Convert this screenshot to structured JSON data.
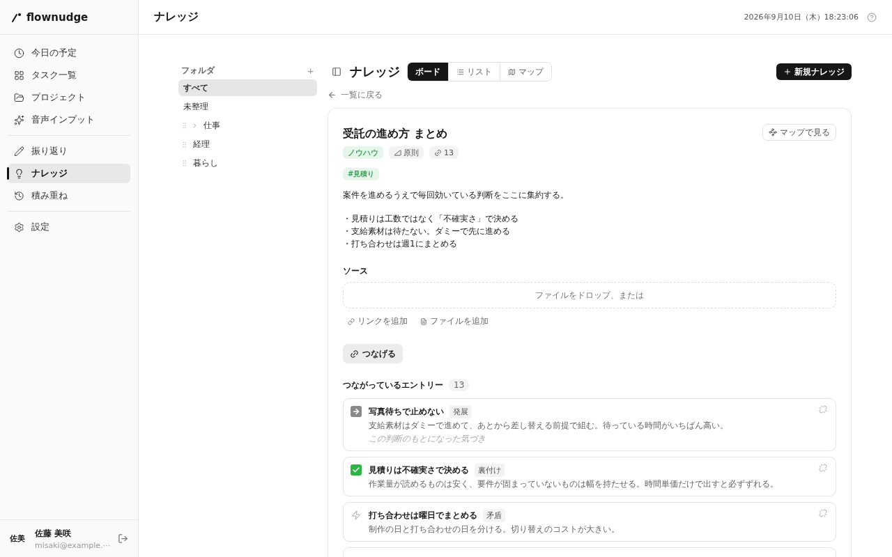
{
  "brand": {
    "name": "flownudge"
  },
  "nav": [
    [
      {
        "label": "今日の予定",
        "selected": false
      },
      {
        "label": "タスク一覧",
        "selected": false
      },
      {
        "label": "プロジェクト",
        "selected": false
      },
      {
        "label": "音声インプット",
        "selected": false
      }
    ],
    [
      {
        "label": "振り返り",
        "selected": false
      },
      {
        "label": "ナレッジ",
        "selected": true
      },
      {
        "label": "積み重ね",
        "selected": false
      }
    ],
    [
      {
        "label": "設定",
        "selected": false
      }
    ]
  ],
  "user": {
    "avatar": "佐美",
    "name": "佐藤 美咲",
    "email": "misaki@example.⋯"
  },
  "header": {
    "title": "ナレッジ",
    "datetime": "2026年9月10日（木）18:23:06"
  },
  "folders": {
    "title": "フォルダ",
    "add": "+",
    "items": [
      {
        "label": "すべて",
        "kind": "system",
        "selected": true
      },
      {
        "label": "未整理",
        "kind": "system",
        "selected": false
      },
      {
        "label": "仕事",
        "kind": "user",
        "selected": false,
        "expanded": false
      },
      {
        "label": "経理",
        "kind": "user",
        "selected": false
      },
      {
        "label": "暮らし",
        "kind": "user",
        "selected": false
      }
    ]
  },
  "page": {
    "title": "ナレッジ",
    "tabs": [
      {
        "label": "ボード",
        "selected": true
      },
      {
        "label": "リスト",
        "selected": false
      },
      {
        "label": "マップ",
        "selected": false
      }
    ],
    "new_button": "新規ナレッジ",
    "back": "一覧に戻る"
  },
  "detail": {
    "title": "受託の進め方 まとめ",
    "map_button": "マップで見る",
    "type_tag": "ノウハウ",
    "category": "原則",
    "link_count": "13",
    "hashtag": "#見積り",
    "intro": "案件を進めるうえで毎回効いている判断をここに集約する。",
    "bullets": [
      "・見積りは工数ではなく「不確実さ」で決める",
      "・支給素材は待たない。ダミーで先に進める",
      "・打ち合わせは週1にまとめる"
    ],
    "source_title": "ソース",
    "dropzone": "ファイルをドロップ、または",
    "add_link": "リンクを追加",
    "add_file": "ファイルを追加",
    "connect_button": "つなげる",
    "entries_title": "つながっているエントリー",
    "entries_count": "13",
    "entries": [
      {
        "kind": "develop",
        "title": "写真待ちで止めない",
        "relation": "発展",
        "description": "支給素材はダミーで進めて、あとから差し替える前提で組む。待っている時間がいちばん高い。",
        "note": "この判断のもとになった気づき"
      },
      {
        "kind": "support",
        "title": "見積りは不確実さで決める",
        "relation": "裏付け",
        "description": "作業量が読めるものは安く、要件が固まっていないものは幅を持たせる。時間単価だけで出すと必ずずれる。"
      },
      {
        "kind": "conflict",
        "title": "打ち合わせは曜日でまとめる",
        "relation": "矛盾",
        "description": "制作の日と打ち合わせの日を分ける。切り替えのコストが大きい。"
      }
    ]
  }
}
